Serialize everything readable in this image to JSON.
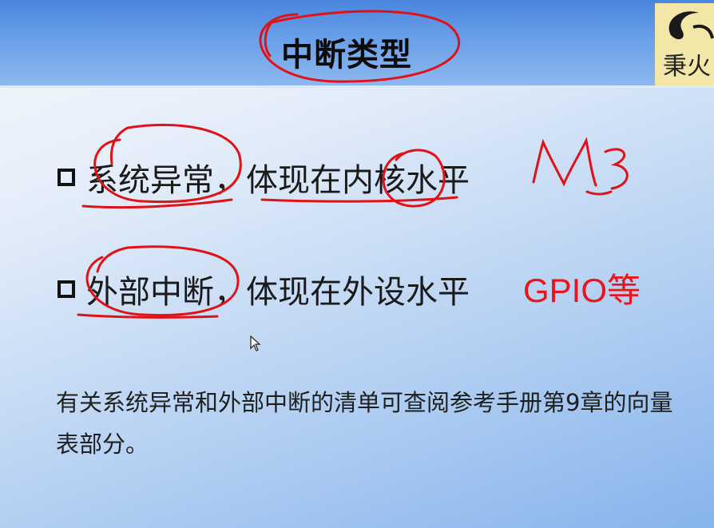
{
  "slide": {
    "title": "中断类型",
    "logo_text": "秉火",
    "bullets": [
      {
        "text": "系统异常，体现在内核水平"
      },
      {
        "text": "外部中断，体现在外设水平"
      }
    ],
    "handwritten_note": "M3",
    "red_annotation": "GPIO等",
    "paragraph": "有关系统异常和外部中断的清单可查阅参考手册第9章的向量表部分。"
  },
  "colors": {
    "header_blue": "#4a86de",
    "annotation_red": "#e8161c",
    "logo_bg": "#f3e7a8"
  }
}
